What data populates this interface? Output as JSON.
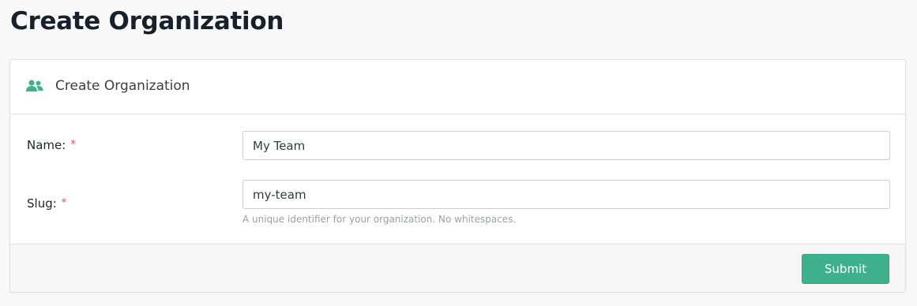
{
  "page": {
    "title": "Create Organization"
  },
  "card": {
    "header": {
      "icon": "users-icon",
      "title": "Create Organization"
    },
    "fields": {
      "name": {
        "label": "Name:",
        "required_mark": "*",
        "value": "My Team"
      },
      "slug": {
        "label": "Slug:",
        "required_mark": "*",
        "value": "my-team",
        "help": "A unique identifier for your organization. No whitespaces."
      }
    },
    "footer": {
      "submit_label": "Submit"
    }
  },
  "colors": {
    "accent": "#3eb08b",
    "required": "#d9534f"
  }
}
